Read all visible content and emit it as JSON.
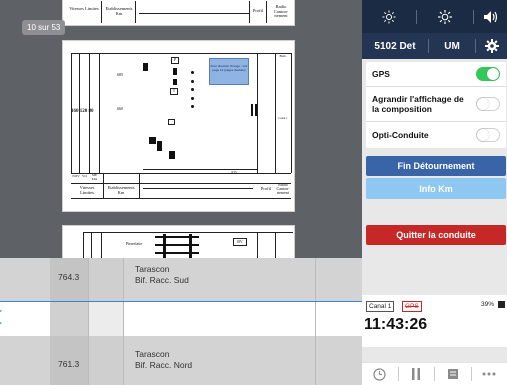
{
  "document": {
    "page_counter": "10 sur 53",
    "top_page": {
      "col1": "Vitesses Limites",
      "col2": "Etablissements Km",
      "col3": "Profil",
      "col4": "Radio Canton-nement"
    },
    "mid_page": {
      "speeds": "160 120 80",
      "label_km1": "685",
      "label_km2": "660",
      "blue_box_text": "Pour direction Orange - voir page 13 (pages doubles)",
      "bottom_left": "NOV",
      "bottom_vo": "VO",
      "bottom_me": "ME MA",
      "footer_col1": "Vitesses Limites",
      "footer_col2": "Etablissements Km",
      "footer_col3": "Profil",
      "footer_col4": "Radio Canton-nement",
      "bal": "BAL",
      "canal": "Canal 1",
      "signal_p": "P",
      "signal_t": "T",
      "pk": "635"
    },
    "bottom_page": {
      "station": "Pierrelatte",
      "box": "BV"
    }
  },
  "right_panel": {
    "top_icons": [
      "brightness-low-icon",
      "brightness-high-icon",
      "volume-icon"
    ],
    "train_number": "5102 Det",
    "unit": "UM",
    "settings": [
      {
        "label": "GPS",
        "on": true
      },
      {
        "label": "Agrandir l'affichage de la composition",
        "on": false
      },
      {
        "label": "Opti-Conduite",
        "on": false
      }
    ],
    "fin_detournement": "Fin Détournement",
    "info_km": "Info Km",
    "quitter": "Quitter la conduite",
    "canal": "Canal 1",
    "gps_chip": "GPS",
    "battery": "39%",
    "time": "11:43:26",
    "colors": {
      "header_dark": "#1c2b44",
      "header": "#243553",
      "blue_button": "#3a64a8",
      "light_blue_button": "#8ec8f2",
      "red_button": "#c62828",
      "toggle_on": "#34c759"
    }
  },
  "grid": {
    "rows": [
      {
        "km": "764.3",
        "station": "Tarascon",
        "sub": "Bif. Racc. Sud"
      },
      {
        "km": "",
        "station": "",
        "sub": ""
      },
      {
        "km": "761.3",
        "station": "Tarascon",
        "sub": "Bif. Racc. Nord"
      }
    ]
  }
}
